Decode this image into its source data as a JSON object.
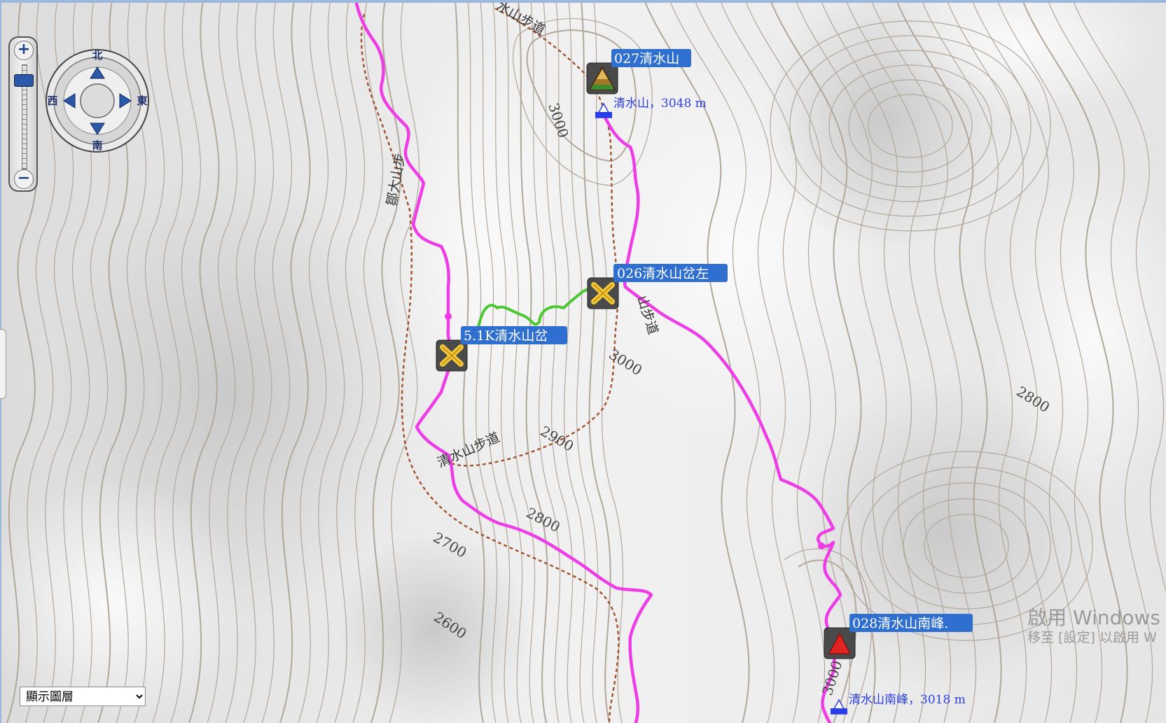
{
  "map": {
    "waypoints": [
      {
        "id": "027",
        "label": "027清水山",
        "icon": "peak-camp-icon"
      },
      {
        "id": "026",
        "label": "026清水山岔左",
        "icon": "junction-x-icon"
      },
      {
        "id": "5.1k",
        "label": "5.1K清水山岔",
        "icon": "junction-x-icon"
      },
      {
        "id": "028",
        "label": "028清水山南峰.",
        "icon": "red-triangle-summit-icon"
      }
    ],
    "peaks": [
      {
        "name": "清水山，3048 m",
        "icon": "blue-peak-icon"
      },
      {
        "name": "清水山南峰，3018 m",
        "icon": "blue-peak-icon"
      }
    ],
    "contour_labels": [
      "3000",
      "3000",
      "2900",
      "2800",
      "2700",
      "2600",
      "2800",
      "3000"
    ],
    "trail_labels": [
      "水山步道",
      "鄒大山步",
      "清水山步道",
      "山步道"
    ],
    "colors": {
      "track": "#ee3de6",
      "side_track": "#4bc832",
      "trail": "#a0522d",
      "contour": "#b3a79a",
      "label_bg": "#2f6fd0"
    }
  },
  "controls": {
    "zoom_in": "+",
    "zoom_out": "−",
    "compass": {
      "north": "北",
      "south": "南",
      "east": "東",
      "west": "西"
    },
    "layer_select": {
      "selected": "顯示圖層",
      "options": [
        "顯示圖層"
      ]
    }
  },
  "watermark": {
    "title": "啟用 Windows",
    "subtitle": "移至 [設定] 以啟用 W"
  }
}
